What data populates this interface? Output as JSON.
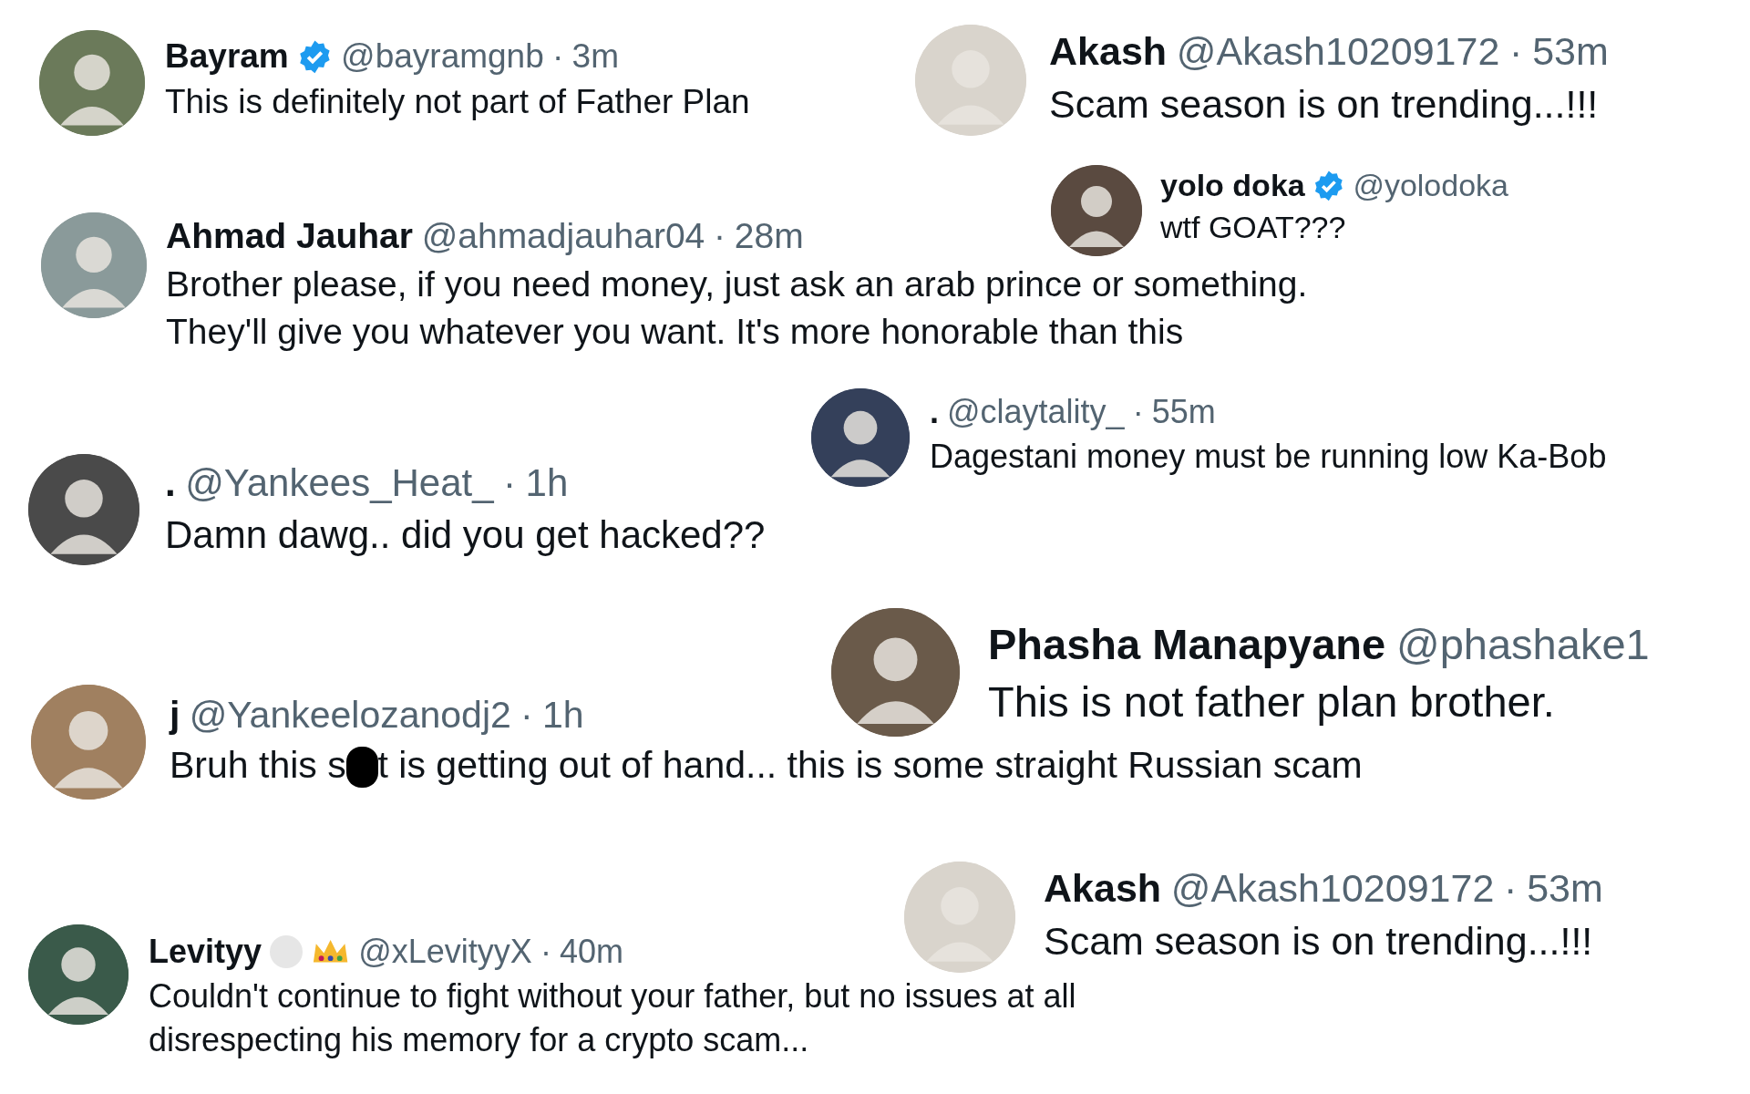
{
  "tweets": [
    {
      "name": "Bayram",
      "verified": true,
      "handle": "@bayramgnb",
      "separator": "·",
      "time": "3m",
      "lines": [
        "This is definitely not part of Father Plan"
      ]
    },
    {
      "name": "Akash",
      "verified": false,
      "handle": "@Akash10209172",
      "separator": "·",
      "time": "53m",
      "lines": [
        "Scam season is on trending...!!!"
      ]
    },
    {
      "name": "yolo doka",
      "verified": true,
      "handle": "@yolodoka",
      "lines": [
        "wtf GOAT???"
      ]
    },
    {
      "name": "Ahmad Jauhar",
      "verified": false,
      "handle": "@ahmadjauhar04",
      "separator": "·",
      "time": "28m",
      "lines": [
        "Brother please, if you need money, just ask an arab prince or something.",
        "They'll give you whatever you want. It's more honorable than this"
      ]
    },
    {
      "name": ".",
      "verified": false,
      "handle": "@claytality_",
      "separator": "·",
      "time": "55m",
      "lines": [
        "Dagestani money must be running low Ka-Bob"
      ]
    },
    {
      "name": ".",
      "verified": false,
      "handle": "@Yankees_Heat_",
      "separator": "·",
      "time": "1h",
      "lines": [
        "Damn dawg.. did you get hacked??"
      ]
    },
    {
      "name": "Phasha Manapyane",
      "verified": false,
      "handle": "@phashake1",
      "lines": [
        "This is not father plan brother."
      ]
    },
    {
      "name": "j",
      "verified": false,
      "handle": "@Yankeelozanodj2",
      "separator": "·",
      "time": "1h",
      "lines": [
        [
          "Bruh this s",
          "t is getting out of hand... this is some straight Russian scam"
        ]
      ]
    },
    {
      "name": "Akash",
      "verified": false,
      "handle": "@Akash10209172",
      "separator": "·",
      "time": "53m",
      "lines": [
        "Scam season is on trending...!!!"
      ]
    },
    {
      "name": "Levityy",
      "verified": false,
      "badges": [
        {
          "kind": "circle"
        },
        {
          "kind": "crown"
        }
      ],
      "handle": "@xLevityyX",
      "separator": "·",
      "time": "40m",
      "lines": [
        "Couldn't continue to fight without your father, but no issues at all",
        "disrespecting his memory for a crypto scam..."
      ]
    }
  ]
}
